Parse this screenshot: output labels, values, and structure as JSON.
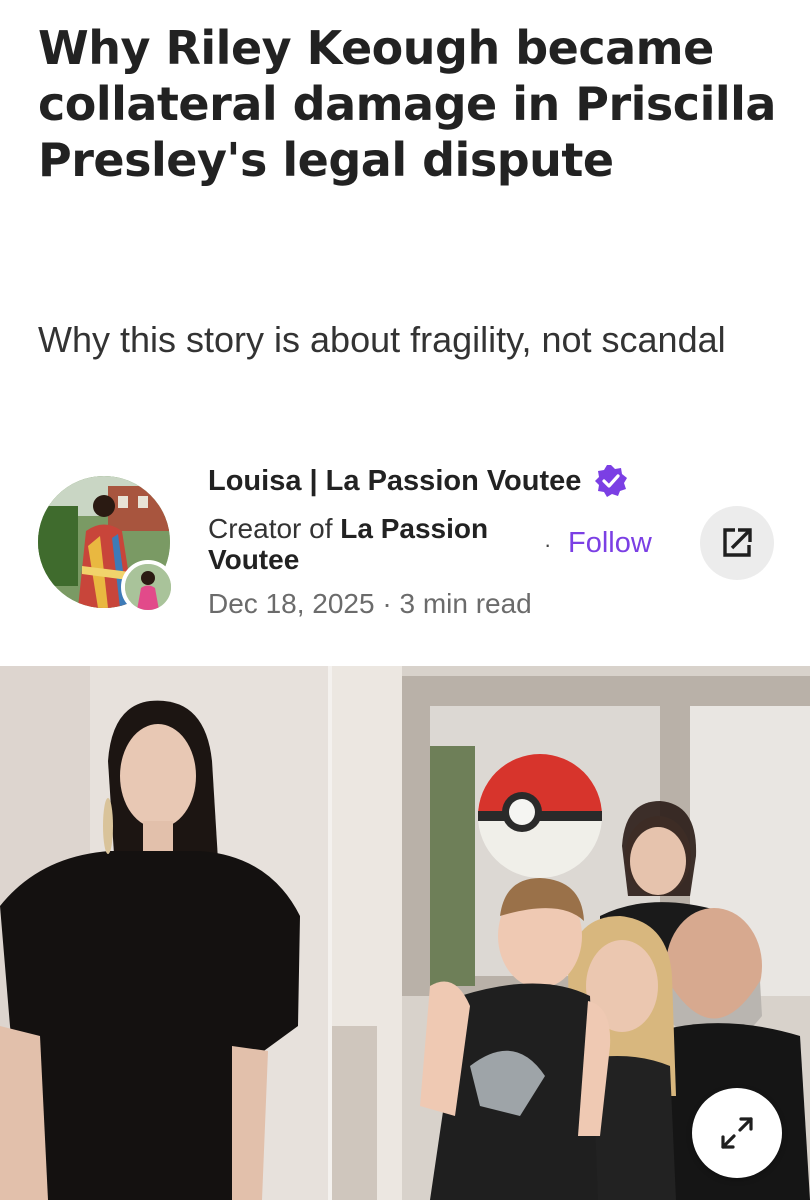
{
  "article": {
    "title": "Why Riley Keough became collateral damage in Priscilla Presley's legal dispute",
    "subtitle": "Why this story is about fragility, not scandal"
  },
  "author": {
    "name": "Louisa | La Passion Voutee",
    "creator_prefix": "Creator of ",
    "creator_publication": "La Passion Voutee",
    "dot": "·",
    "follow_label": "Follow",
    "verified_icon": "verified-badge-icon",
    "verified_color": "#7b3fe4"
  },
  "meta": {
    "date": "Dec 18, 2025",
    "separator": " · ",
    "read_time": "3 min read"
  },
  "actions": {
    "share_icon": "open-external-icon",
    "expand_icon": "expand-arrows-icon"
  },
  "colors": {
    "accent": "#7b3fe4",
    "text": "#222222",
    "muted": "#6b6b6b"
  }
}
